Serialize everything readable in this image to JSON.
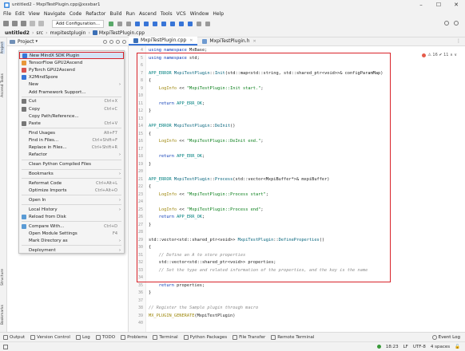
{
  "window": {
    "title": "untitled2 - MxpiTestPlugin.cpp@xxxbar1",
    "controls": [
      "–",
      "☐",
      "✕"
    ]
  },
  "menu": [
    "File",
    "Edit",
    "View",
    "Navigate",
    "Code",
    "Refactor",
    "Build",
    "Run",
    "Ascend",
    "Tools",
    "VCS",
    "Window",
    "Help"
  ],
  "toolbar": {
    "run_config": "Add Configuration..."
  },
  "breadcrumb": [
    "untitled2",
    "src",
    "mxpitestplugin",
    "MxpiTestPlugin.cpp"
  ],
  "project_panel": {
    "label": "Project",
    "arrow": "▾"
  },
  "left_tool_labels": [
    "Project",
    "Ascend Tasks"
  ],
  "left_tool_labels_bottom": [
    "Structure",
    "Bookmarks"
  ],
  "tabs": [
    {
      "label": "MxpiTestPlugin.cpp",
      "active": true
    },
    {
      "label": "MxpiTestPlugin.h",
      "active": false
    }
  ],
  "context_menu": [
    {
      "label": "New MindX SDK Plugin",
      "shortcut": "",
      "submenu": false,
      "icon": "#3875d7",
      "highlight": true
    },
    {
      "label": "TensorFlow GPU2Ascend",
      "shortcut": "",
      "submenu": false,
      "icon": "#e8973a"
    },
    {
      "label": "PyTorch GPU2Ascend",
      "shortcut": "",
      "submenu": false,
      "icon": "#d9534f"
    },
    {
      "label": "X2MindSpore",
      "shortcut": "",
      "submenu": false,
      "icon": "#3875d7"
    },
    {
      "label": "New",
      "shortcut": "",
      "submenu": true,
      "icon": ""
    },
    {
      "label": "Add Framework Support...",
      "shortcut": "",
      "submenu": false,
      "icon": "",
      "sep_after": true
    },
    {
      "label": "Cut",
      "shortcut": "Ctrl+X",
      "submenu": false,
      "icon": "#777777"
    },
    {
      "label": "Copy",
      "shortcut": "Ctrl+C",
      "submenu": false,
      "icon": "#777777"
    },
    {
      "label": "Copy Path/Reference...",
      "shortcut": "",
      "submenu": false,
      "icon": ""
    },
    {
      "label": "Paste",
      "shortcut": "Ctrl+V",
      "submenu": false,
      "icon": "#777777",
      "sep_after": true
    },
    {
      "label": "Find Usages",
      "shortcut": "Alt+F7",
      "submenu": false,
      "icon": ""
    },
    {
      "label": "Find in Files...",
      "shortcut": "Ctrl+Shift+F",
      "submenu": false,
      "icon": ""
    },
    {
      "label": "Replace in Files...",
      "shortcut": "Ctrl+Shift+R",
      "submenu": false,
      "icon": ""
    },
    {
      "label": "Refactor",
      "shortcut": "",
      "submenu": true,
      "icon": "",
      "sep_after": true
    },
    {
      "label": "Clean Python Compiled Files",
      "shortcut": "",
      "submenu": false,
      "icon": "",
      "sep_after": true
    },
    {
      "label": "Bookmarks",
      "shortcut": "",
      "submenu": true,
      "icon": "",
      "sep_after": true
    },
    {
      "label": "Reformat Code",
      "shortcut": "Ctrl+Alt+L",
      "submenu": false,
      "icon": ""
    },
    {
      "label": "Optimize Imports",
      "shortcut": "Ctrl+Alt+O",
      "submenu": false,
      "icon": "",
      "sep_after": true
    },
    {
      "label": "Open In",
      "shortcut": "",
      "submenu": true,
      "icon": "",
      "sep_after": true
    },
    {
      "label": "Local History",
      "shortcut": "",
      "submenu": true,
      "icon": ""
    },
    {
      "label": "Reload from Disk",
      "shortcut": "",
      "submenu": false,
      "icon": "#5a9bd5",
      "sep_after": true
    },
    {
      "label": "Compare With...",
      "shortcut": "Ctrl+D",
      "submenu": false,
      "icon": "#5a9bd5"
    },
    {
      "label": "Open Module Settings",
      "shortcut": "F4",
      "submenu": false,
      "icon": ""
    },
    {
      "label": "Mark Directory as",
      "shortcut": "",
      "submenu": true,
      "icon": "",
      "sep_after": true
    },
    {
      "label": "Deployment",
      "shortcut": "",
      "submenu": true,
      "icon": ""
    }
  ],
  "editor": {
    "inspection": "⚠ 16  ✔ 11  ∧  ∨",
    "line_numbers": [
      "4",
      "5",
      "6",
      "7",
      "8",
      "9",
      "10",
      "11",
      "12",
      "13",
      "14",
      "15",
      "16",
      "17",
      "18",
      "19",
      "20",
      "21",
      "22",
      "23",
      "24",
      "25",
      "26",
      "27",
      "28",
      "29",
      "30",
      "31",
      "32",
      "33",
      "34",
      "35",
      "36",
      "37",
      "38",
      "39",
      "40"
    ],
    "lines": [
      [
        [
          "kw",
          "using namespace "
        ],
        [
          "",
          "MxBase;"
        ]
      ],
      [
        [
          "kw",
          "using namespace "
        ],
        [
          "",
          "std;"
        ]
      ],
      [],
      [
        [
          "ty",
          "APP_ERROR "
        ],
        [
          "fn",
          "MxpiTestPlugin"
        ],
        [
          "",
          "::"
        ],
        [
          "fn",
          "Init"
        ],
        [
          "",
          "(std::map<std::string, std::shared_ptr<void>>& configParamMap)"
        ]
      ],
      [
        [
          "",
          "{"
        ]
      ],
      [
        [
          "",
          "    "
        ],
        [
          "mac",
          "LogInfo"
        ],
        [
          "",
          " << "
        ],
        [
          "str",
          "\"MxpiTestPlugin::Init start.\""
        ],
        [
          "",
          ";"
        ]
      ],
      [],
      [
        [
          "",
          "    "
        ],
        [
          "kw",
          "return "
        ],
        [
          "ty",
          "APP_ERR_OK"
        ],
        [
          "",
          ";"
        ]
      ],
      [
        [
          "",
          "}"
        ]
      ],
      [],
      [
        [
          "ty",
          "APP_ERROR "
        ],
        [
          "fn",
          "MxpiTestPlugin"
        ],
        [
          "",
          "::"
        ],
        [
          "fn",
          "DeInit"
        ],
        [
          "",
          "()"
        ]
      ],
      [
        [
          "",
          "{"
        ]
      ],
      [
        [
          "",
          "    "
        ],
        [
          "mac",
          "LogInfo"
        ],
        [
          "",
          " << "
        ],
        [
          "str",
          "\"MxpiTestPlugin::DeInit end.\""
        ],
        [
          "",
          ";"
        ]
      ],
      [],
      [
        [
          "",
          "    "
        ],
        [
          "kw",
          "return "
        ],
        [
          "ty",
          "APP_ERR_OK"
        ],
        [
          "",
          ";"
        ]
      ],
      [
        [
          "",
          "}"
        ]
      ],
      [],
      [
        [
          "ty",
          "APP_ERROR "
        ],
        [
          "fn",
          "MxpiTestPlugin"
        ],
        [
          "",
          "::"
        ],
        [
          "fn",
          "Process"
        ],
        [
          "",
          "(std::vector<MxpiBuffer*>& mxpiBuffer)"
        ]
      ],
      [
        [
          "",
          "{"
        ]
      ],
      [
        [
          "",
          "    "
        ],
        [
          "mac",
          "LogInfo"
        ],
        [
          "",
          " << "
        ],
        [
          "str",
          "\"MxpiTestPlugin::Process start\""
        ],
        [
          "",
          ";"
        ]
      ],
      [],
      [
        [
          "",
          "    "
        ],
        [
          "mac",
          "LogInfo"
        ],
        [
          "",
          " << "
        ],
        [
          "str",
          "\"MxpiTestPlugin::Process end\""
        ],
        [
          "",
          ";"
        ]
      ],
      [
        [
          "",
          "    "
        ],
        [
          "kw",
          "return "
        ],
        [
          "ty",
          "APP_ERR_OK"
        ],
        [
          "",
          ";"
        ]
      ],
      [
        [
          "",
          "}"
        ]
      ],
      [],
      [
        [
          "",
          "std::vector<std::shared_ptr<void>> "
        ],
        [
          "fn",
          "MxpiTestPlugin"
        ],
        [
          "",
          "::"
        ],
        [
          "fn",
          "DefineProperties"
        ],
        [
          "",
          "()"
        ]
      ],
      [
        [
          "",
          "{"
        ]
      ],
      [
        [
          "",
          "    "
        ],
        [
          "cm",
          "// Define an A to store properties"
        ]
      ],
      [
        [
          "",
          "    std::vector<std::shared_ptr<void>> properties;"
        ]
      ],
      [
        [
          "",
          "    "
        ],
        [
          "cm",
          "// Set the type and related information of the properties, and the key is the name"
        ]
      ],
      [],
      [
        [
          "",
          "    "
        ],
        [
          "kw",
          "return "
        ],
        [
          "",
          "properties;"
        ]
      ],
      [
        [
          "",
          "}"
        ]
      ],
      [],
      [
        [
          "cm",
          "// Register the Sample plugin through macro"
        ]
      ],
      [
        [
          "mac",
          "MX_PLUGIN_GENERATE"
        ],
        [
          "",
          "(MxpiTestPlugin)"
        ]
      ],
      []
    ]
  },
  "bottom_tabs": [
    "Output",
    "Version Control",
    "Log",
    "TODO",
    "Problems",
    "Terminal",
    "Python Packages",
    "File Transfer",
    "Remote Terminal"
  ],
  "event_log": "Event Log",
  "status": {
    "position": "18:23",
    "line_sep": "LF",
    "encoding": "UTF-8",
    "indent": "4 spaces"
  }
}
